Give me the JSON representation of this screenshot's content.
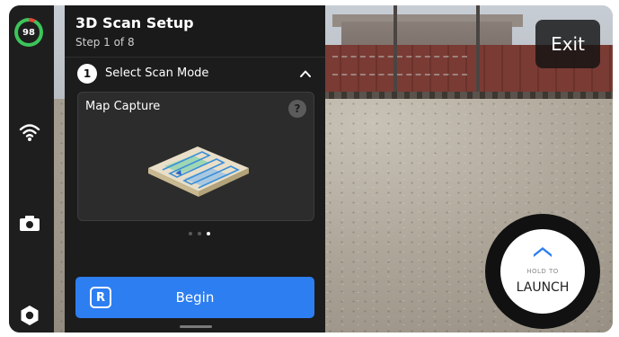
{
  "status": {
    "battery_percent": "98"
  },
  "panel": {
    "title": "3D Scan Setup",
    "subtitle": "Step 1 of 8",
    "step": {
      "number": "1",
      "label": "Select Scan Mode"
    },
    "card": {
      "title": "Map Capture",
      "help": "?"
    },
    "pagination": {
      "count": 3,
      "active_index": 2
    },
    "begin": {
      "key": "R",
      "label": "Begin"
    }
  },
  "exit_label": "Exit",
  "launch": {
    "hint": "HOLD TO",
    "label": "LAUNCH"
  },
  "colors": {
    "accent": "#2d7ef0",
    "battery_ok": "#3cc55a",
    "battery_low": "#e24a3b"
  },
  "icons": [
    "wifi-icon",
    "camera-icon",
    "settings-icon",
    "chevron-up-icon",
    "help-icon",
    "launch-chevron-icon"
  ]
}
